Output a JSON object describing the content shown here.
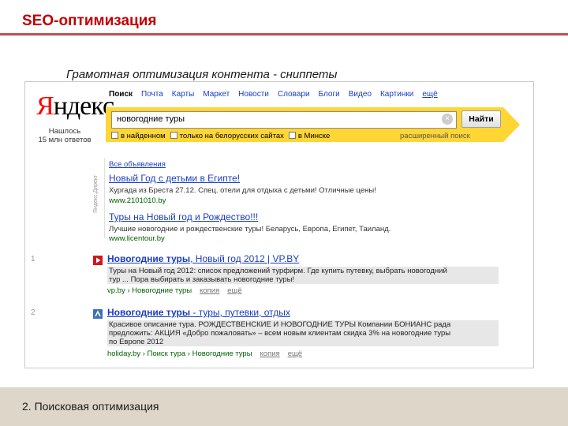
{
  "slide": {
    "title": "SEO-оптимизация",
    "subtitle": "Грамотная оптимизация контента - сниппеты",
    "footer": "2. Поисковая оптимизация"
  },
  "yandex": {
    "logo_first": "Я",
    "logo_rest": "ндекс",
    "found_line1": "Нашлось",
    "found_line2": "15 млн ответов",
    "tabs": [
      "Поиск",
      "Почта",
      "Карты",
      "Маркет",
      "Новости",
      "Словари",
      "Блоги",
      "Видео",
      "Картинки",
      "ещё"
    ],
    "search_value": "новогодние туры",
    "search_button": "Найти",
    "filters": [
      "в найденном",
      "только на белорусских сайтах",
      "в Минске"
    ],
    "advanced": "расширенный поиск"
  },
  "ads": {
    "header": "Все объявления",
    "vertical_label": "Яндекс.Директ",
    "items": [
      {
        "title": "Новый Год с детьми в Египте!",
        "text": "Хургада из Бреста 27.12. Спец. отели для отдыха с детьми! Отличные цены!",
        "url": "www.2101010.by"
      },
      {
        "title": "Туры на Новый год и Рождество!!!",
        "text": "Лучшие новогодние и рождественские туры! Беларусь, Европа, Египет, Таиланд.",
        "url": "www.licentour.by"
      }
    ]
  },
  "results": [
    {
      "rank": "1",
      "title_bold": "Новогодние туры",
      "title_rest": ", Новый год 2012 | VP.BY",
      "snippet": [
        "Туры на Новый год 2012: список предложений турфирм. Где купить путевку, выбрать новогодний",
        "тур ... Пора выбирать и заказывать новогодние туры!"
      ],
      "url": "vp.by › Новогодние туры",
      "link1": "копия",
      "link2": "ещё"
    },
    {
      "rank": "2",
      "title_bold": "Новогодние туры",
      "title_rest": " - туры, путевки, отдых",
      "snippet": [
        "Красивое описание тура. РОЖДЕСТВЕНСКИЕ И НОВОГОДНИЕ ТУРЫ Компании БОНИАНС рада",
        "предложить: АКЦИЯ «Добро пожаловать» – всем новым клиентам скидка 3% на новогодние туры",
        "по Европе 2012"
      ],
      "url": "holiday.by › Поиск тура › Новогодние туры",
      "link1": "копия",
      "link2": "ещё"
    }
  ],
  "colors": {
    "accent_red": "#c00000",
    "yandex_yellow": "#ffd633",
    "link_blue": "#1a3dc1",
    "url_green": "#006000"
  }
}
